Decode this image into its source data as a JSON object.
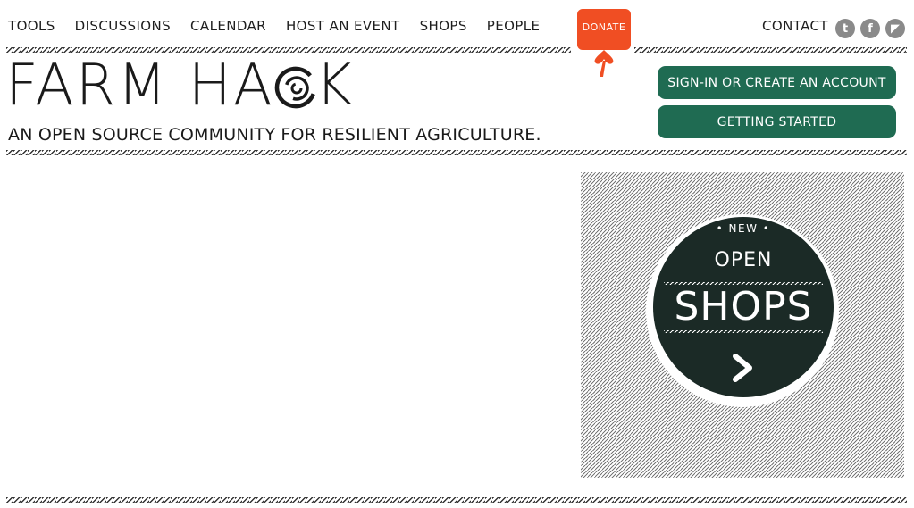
{
  "nav": {
    "items": [
      {
        "label": "TOOLS"
      },
      {
        "label": "DISCUSSIONS"
      },
      {
        "label": "CALENDAR"
      },
      {
        "label": "HOST AN EVENT"
      },
      {
        "label": "SHOPS"
      },
      {
        "label": "PEOPLE"
      }
    ],
    "contact": "CONTACT"
  },
  "donate": {
    "label": "DONATE",
    "color": "#f04e23"
  },
  "social": [
    {
      "icon": "twitter-icon",
      "glyph": "t"
    },
    {
      "icon": "facebook-icon",
      "glyph": "f"
    },
    {
      "icon": "rss-icon",
      "glyph": "◤"
    }
  ],
  "brand": {
    "logo_part1": "FARM HA",
    "logo_part2": "K",
    "tagline": "AN OPEN SOURCE COMMUNITY FOR RESILIENT AGRICULTURE."
  },
  "account": {
    "signin_label": "SIGN-IN OR CREATE AN ACCOUNT",
    "getting_started_label": "GETTING STARTED",
    "button_color": "#1f6b52"
  },
  "promo": {
    "new_label": "• NEW •",
    "open_label": "OPEN",
    "shops_label": "SHOPS",
    "arrow_icon": "chevron-right-icon",
    "badge_color": "#1b2a26"
  }
}
